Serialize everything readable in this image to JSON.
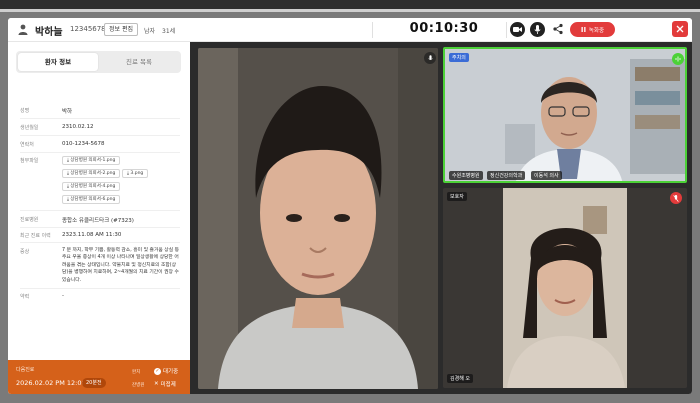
{
  "header": {
    "patient_name": "박하늘",
    "patient_id": "12345678",
    "edit_button": "정보 편집",
    "sex": "남자",
    "age": "31세",
    "timer": "00:10:30",
    "record_button": "녹화중"
  },
  "left_panel": {
    "tabs": [
      {
        "label": "환자 정보"
      },
      {
        "label": "진료 목록"
      }
    ],
    "info": {
      "name_label": "성명",
      "name_value": "박하",
      "birth_label": "생년월일",
      "birth_value": "2310.02.12",
      "phone_label": "연락처",
      "phone_value": "010-1234-5678",
      "files_label": "첨부파일",
      "files": [
        "상담병원 의뢰서-1.png",
        "상담병원 의뢰서-2.png",
        "3.png",
        "상담병원 의뢰서-4.png",
        "상담병원 의뢰서-6.png"
      ],
      "hospital_label": "진료병원",
      "hospital_value": "종합소 유클리드타크 (#7323)",
      "last_visit_label": "최근 진료 이력",
      "last_visit_value": "2323.11.08 AM 11:30",
      "memo_label": "증상",
      "memo_value": "7 분 까지, 학부 기쁨, 활동력 감소, 흥미 및 즐거움 상실 등 주요 우울 증상이 4개 이상 나타나며 일상생활에 상당한 어려움을 겪는 상태입니다. 약물치료 및 정신치료의 조합(상담)을 병행하여 치료하며, 2~4개월의 치료 기간이 권장 수 있습니다.",
      "note_label": "약력",
      "note_value": "-"
    }
  },
  "bottom_bar": {
    "label": "다음진료",
    "date": "2026.02.02 PM 12:00",
    "badge": "20분전",
    "sub1": "완치",
    "sub2": "잔병원",
    "check_label": "대기중",
    "close_label": "미접제"
  },
  "video": {
    "main_feed": {
      "label": ""
    },
    "doctor_feed": {
      "role": "주치의",
      "name_tags": [
        "수원조병병원",
        "정신건강의학과",
        "이동석 의사"
      ]
    },
    "guardian_feed": {
      "role": "보호자",
      "name_tag": "김경해 오"
    }
  },
  "colors": {
    "accent_orange": "#d5611a",
    "record_red": "#e23b3b",
    "active_green": "#4cd137",
    "role_blue": "#3b6cd6"
  },
  "icons": {
    "patient": "person-icon",
    "camera": "camera-icon",
    "microphone": "microphone-icon",
    "share": "share-icon",
    "close": "close-icon",
    "file": "file-icon",
    "audio_wave": "audio-wave-icon",
    "mute": "mic-off-icon"
  }
}
